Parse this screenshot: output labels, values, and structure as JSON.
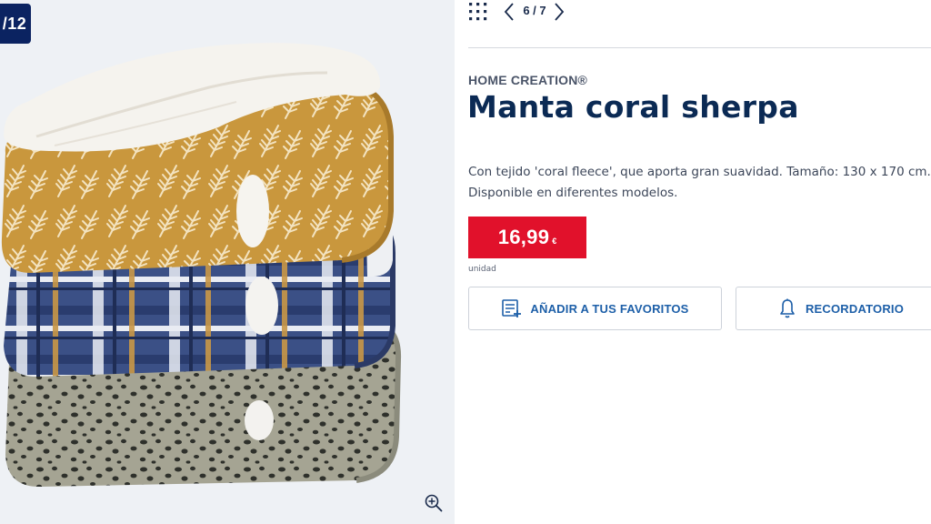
{
  "gallery": {
    "counter_label": "/12"
  },
  "nav": {
    "grid_icon": "grid-icon",
    "counter": "6 / 7",
    "prev_icon": "chevron-left-icon",
    "next_icon": "chevron-right-icon"
  },
  "product": {
    "brand": "HOME CREATION®",
    "title": "Manta coral sherpa",
    "description_lines": [
      "Con tejido 'coral fleece', que aporta gran suavidad. Tamaño: 130 x 170 cm.",
      "Disponible en diferentes modelos."
    ],
    "price": {
      "amount": "16,99",
      "currency": "€",
      "unit": "unidad"
    }
  },
  "actions": {
    "favorites_label": "AÑADIR A TUS FAVORITOS",
    "reminder_label": "RECORDATORIO"
  },
  "colors": {
    "brand_navy": "#0b2361",
    "title_navy": "#0b2a54",
    "price_red": "#e1112b",
    "action_blue": "#1d5fa8",
    "image_bg": "#eef1f5"
  }
}
